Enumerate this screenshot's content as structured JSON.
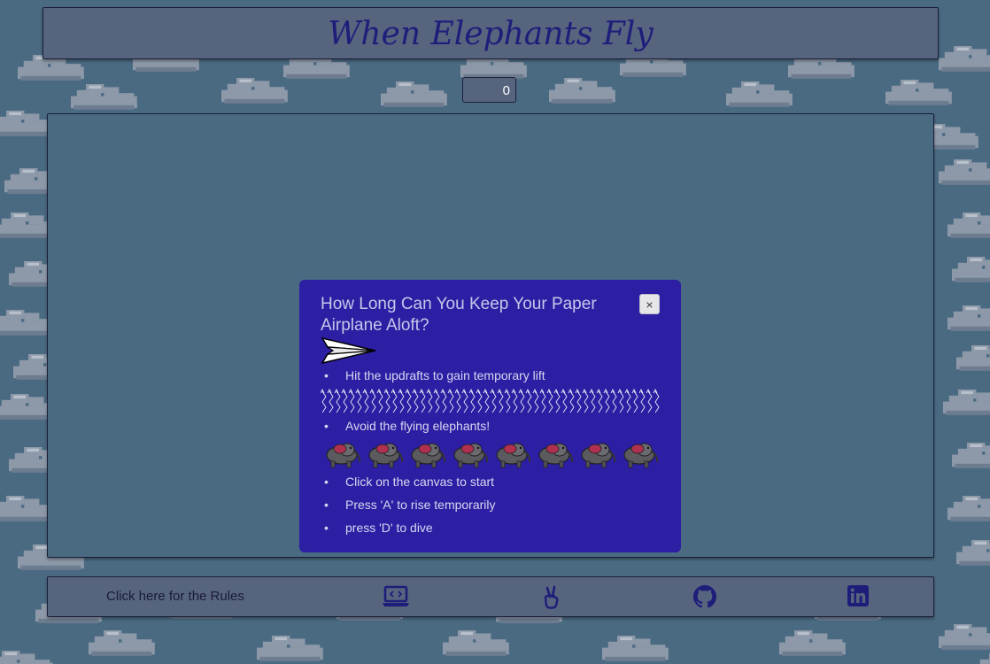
{
  "app": {
    "title": "When Elephants Fly",
    "score": "0"
  },
  "modal": {
    "title": "How Long Can You Keep Your Paper Airplane Aloft?",
    "close_label": "×",
    "rules": [
      "Hit the updrafts to gain temporary lift",
      "Avoid the flying elephants!",
      "Click on the canvas to start",
      "Press 'A' to rise temporarily",
      "press 'D' to dive"
    ]
  },
  "footer": {
    "rules_link": "Click here for the Rules",
    "icons": [
      "portfolio-laptop-icon",
      "peace-sign-icon",
      "github-icon",
      "linkedin-icon"
    ]
  },
  "colors": {
    "background": "#4a6a82",
    "panel": "#56647e",
    "modal": "#2c1fa3",
    "title_text": "#1e1d7a"
  }
}
